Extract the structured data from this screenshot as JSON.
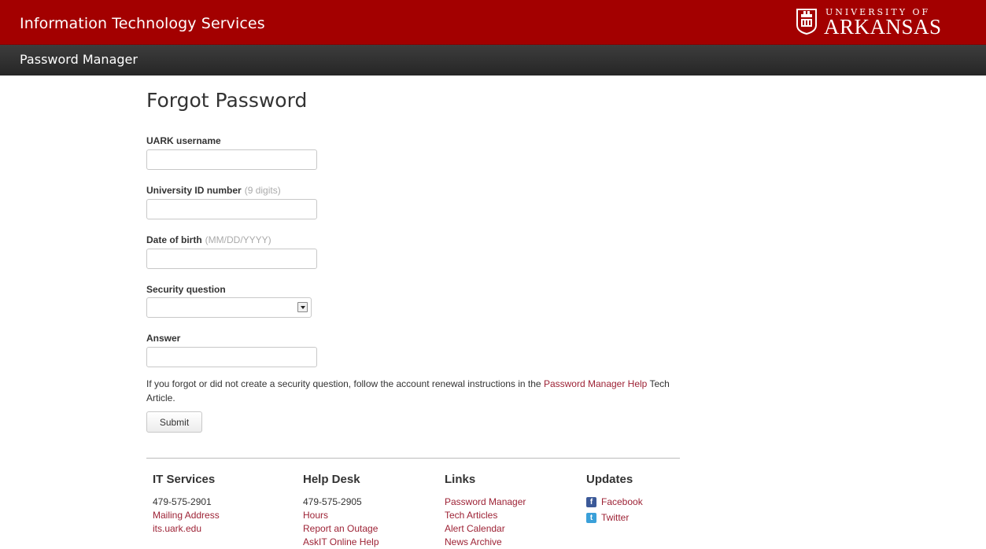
{
  "header": {
    "site_title": "Information Technology Services",
    "logo_top": "UNIVERSITY OF",
    "logo_main": "ARKANSAS"
  },
  "subheader": {
    "title": "Password Manager"
  },
  "form": {
    "heading": "Forgot Password",
    "username": {
      "label": "UARK username",
      "value": ""
    },
    "id_number": {
      "label": "University ID number",
      "hint": "(9 digits)",
      "value": ""
    },
    "dob": {
      "label": "Date of birth",
      "hint": "(MM/DD/YYYY)",
      "value": ""
    },
    "security_question": {
      "label": "Security question",
      "selected": ""
    },
    "answer": {
      "label": "Answer",
      "value": ""
    },
    "instructions_prefix": "If you forgot or did not create a security question, follow the account renewal instructions in the ",
    "instructions_link": "Password Manager Help",
    "instructions_suffix": " Tech Article.",
    "submit_label": "Submit"
  },
  "footer": {
    "it_services": {
      "heading": "IT Services",
      "phone": "479-575-2901",
      "links": [
        "Mailing Address",
        "its.uark.edu"
      ]
    },
    "help_desk": {
      "heading": "Help Desk",
      "phone": "479-575-2905",
      "links": [
        "Hours",
        "Report an Outage",
        "AskIT Online Help"
      ]
    },
    "links": {
      "heading": "Links",
      "links": [
        "Password Manager",
        "Tech Articles",
        "Alert Calendar",
        "News Archive"
      ]
    },
    "updates": {
      "heading": "Updates",
      "facebook": "Facebook",
      "twitter": "Twitter"
    }
  },
  "colors": {
    "brand_red": "#a30000",
    "subbar_dark": "#2e2e2e",
    "link": "#9d2235",
    "facebook": "#3b5998",
    "twitter": "#3aa0d9"
  }
}
